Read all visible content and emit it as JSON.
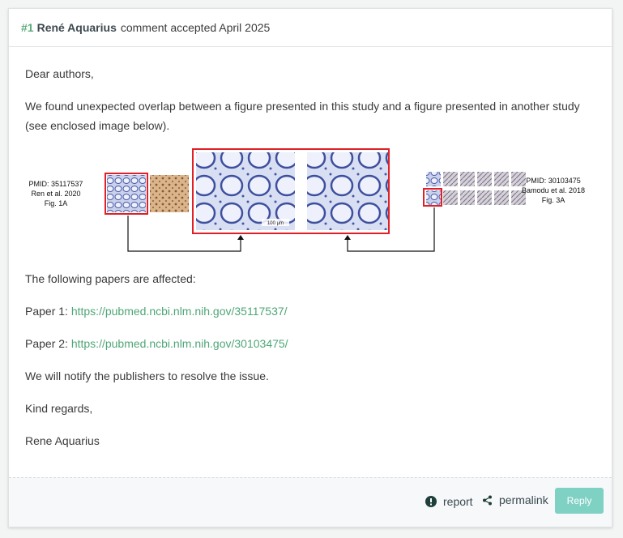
{
  "header": {
    "number": "#1",
    "author": "René Aquarius",
    "status": "comment accepted April 2025"
  },
  "body": {
    "greeting": "Dear authors,",
    "intro": "We found unexpected overlap between a figure presented in this study and a figure presented in another study (see enclosed image below).",
    "affected": "The following papers are affected:",
    "paper1_label": "Paper 1:",
    "paper1_url": "https://pubmed.ncbi.nlm.nih.gov/35117537/",
    "paper2_label": "Paper 2:",
    "paper2_url": "https://pubmed.ncbi.nlm.nih.gov/30103475/",
    "notify": "We will notify the publishers to resolve the issue.",
    "closing": "Kind regards,",
    "signature": "Rene Aquarius"
  },
  "figure": {
    "left_label": [
      "PMID: 35117537",
      "Ren et al. 2020",
      "Fig. 1A"
    ],
    "right_label": [
      "PMID: 30103475",
      "Bamodu et al. 2018",
      "Fig. 3A"
    ],
    "scale_bar": "100 μm",
    "highlight_color": "#e01f26"
  },
  "footer": {
    "report_label": "report",
    "permalink_label": "permalink",
    "reply_label": "Reply"
  },
  "colors": {
    "accent": "#5aab7b",
    "link": "#4fa677",
    "reply_button": "#7fd1c4"
  }
}
